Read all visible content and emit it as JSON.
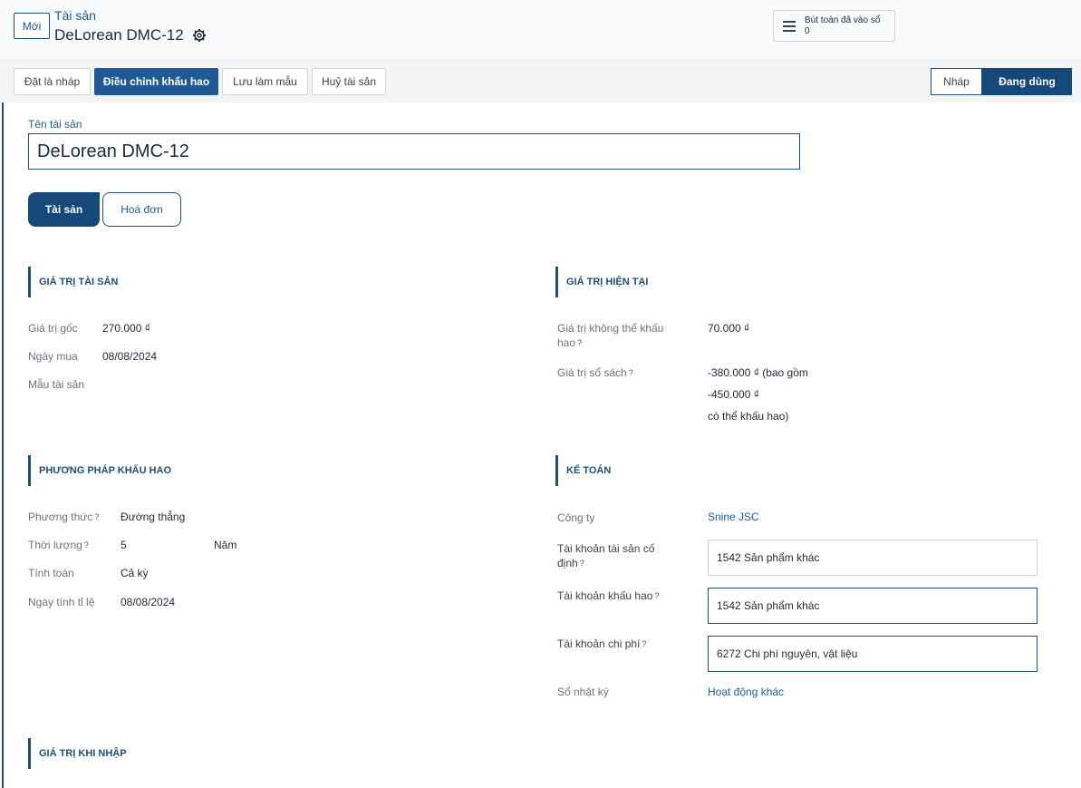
{
  "header": {
    "new_label": "Mới",
    "breadcrumb": "Tài sản",
    "record_title": "DeLorean DMC-12",
    "smart_button": {
      "label": "Bút toán đã vào sổ",
      "count": "0"
    }
  },
  "actions": {
    "set_draft": "Đặt là nháp",
    "modify_depreciation": "Điều chỉnh khấu hao",
    "save_template": "Lưu làm mẫu",
    "cancel_asset": "Huỷ tài sản"
  },
  "status": {
    "draft": "Nháp",
    "running": "Đang dùng",
    "active": "running"
  },
  "form": {
    "name_label": "Tên tài sản",
    "name_value": "DeLorean DMC-12"
  },
  "tabs": [
    {
      "label": "Tài sản",
      "active": true
    },
    {
      "label": "Hoá đơn",
      "active": false
    }
  ],
  "asset_value": {
    "title": "GIÁ TRỊ TÀI SẢN",
    "original_value_label": "Giá trị gốc",
    "original_value": "270.000 ₫",
    "acquisition_date_label": "Ngày mua",
    "acquisition_date": "08/08/2024",
    "model_label": "Mẫu tài sản",
    "model_value": ""
  },
  "current_value": {
    "title": "GIÁ TRỊ HIỆN TẠI",
    "non_depreciable_label_1": "Giá trị không thể khấu",
    "non_depreciable_label_2": "hao",
    "non_depreciable_value": "70.000 ₫",
    "book_value_label": "Giá trị sổ sách",
    "book_value_line1": "-380.000 ₫ (bao gồm",
    "book_value_line2": "-450.000 ₫",
    "book_value_line3": "có thể khấu hao)"
  },
  "depreciation_method": {
    "title": "PHƯƠNG PHÁP KHẤU HAO",
    "method_label": "Phương thức",
    "method_value": "Đường thẳng",
    "duration_label": "Thời lượng",
    "duration_value": "5",
    "duration_unit": "Năm",
    "computation_label": "Tính toán",
    "computation_value": "Cả kỳ",
    "prorata_date_label": "Ngày tính tỉ lệ",
    "prorata_date_value": "08/08/2024"
  },
  "accounting": {
    "title": "KẾ TOÁN",
    "company_label": "Công ty",
    "company_value": "Snine JSC",
    "fixed_asset_account_label_1": "Tài khoản tài sản cố",
    "fixed_asset_account_label_2": "định",
    "fixed_asset_account_value": "1542 Sản phẩm khác",
    "depreciation_account_label": "Tài khoản khấu hao",
    "depreciation_account_value": "1542 Sản phẩm khác",
    "expense_account_label": "Tài khoản chi phí",
    "expense_account_value": "6272 Chi phí nguyên, vật liệu",
    "journal_label": "Sổ nhật ký",
    "journal_value": "Hoạt động khác"
  },
  "import_value": {
    "title": "GIÁ TRỊ KHI NHẬP"
  },
  "colors": {
    "primary": "#17487a",
    "link": "#1f5a96",
    "border": "#d1d5db"
  }
}
